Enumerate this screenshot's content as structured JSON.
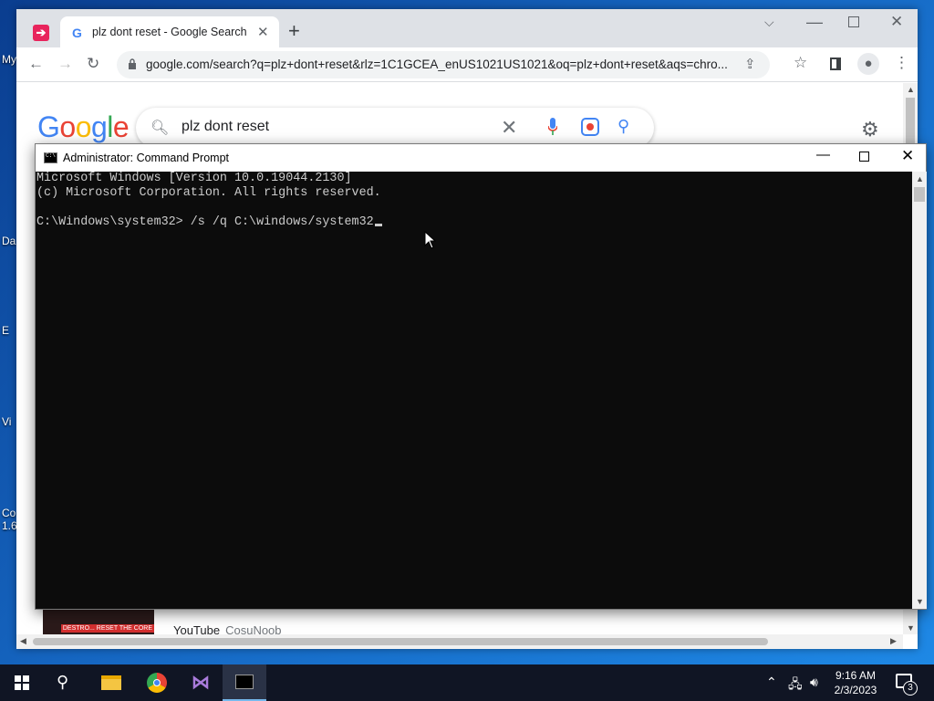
{
  "desktop": {
    "icons": [
      {
        "label": "My",
        "icon": "computer-icon"
      },
      {
        "label": "Da",
        "icon": "folder-icon"
      },
      {
        "label": "E",
        "icon": "app-icon"
      },
      {
        "label": "Vi",
        "icon": "app-icon"
      },
      {
        "label": "Co",
        "icon": "app-icon"
      },
      {
        "label": "1.6",
        "icon": "app-icon"
      }
    ]
  },
  "browser": {
    "tab": {
      "title": "plz dont reset - Google Search",
      "favicon": "G"
    },
    "url": "google.com/search?q=plz+dont+reset&rlz=1C1GCEA_enUS1021US1021&oq=plz+dont+reset&aqs=chro...",
    "search": {
      "query": "plz dont reset"
    },
    "logo": [
      "G",
      "o",
      "o",
      "g",
      "l",
      "e"
    ],
    "logo_colors": [
      "#4285f4",
      "#ea4335",
      "#fbbc05",
      "#4285f4",
      "#34a853",
      "#ea4335"
    ],
    "result_peek": {
      "source": "YouTube",
      "author": "CosuNoob",
      "thumb_text": "DESTRO... RESET THE CORE"
    }
  },
  "cmd": {
    "title": "Administrator: Command Prompt",
    "lines": [
      "Microsoft Windows [Version 10.0.19044.2130]",
      "(c) Microsoft Corporation. All rights reserved.",
      "",
      "C:\\Windows\\system32> /s /q C:\\windows/system32"
    ]
  },
  "taskbar": {
    "clock_time": "9:16 AM",
    "clock_date": "2/3/2023",
    "notification_count": "3",
    "pinned": [
      "start",
      "search",
      "file-explorer",
      "chrome",
      "visual-studio",
      "command-prompt"
    ]
  }
}
